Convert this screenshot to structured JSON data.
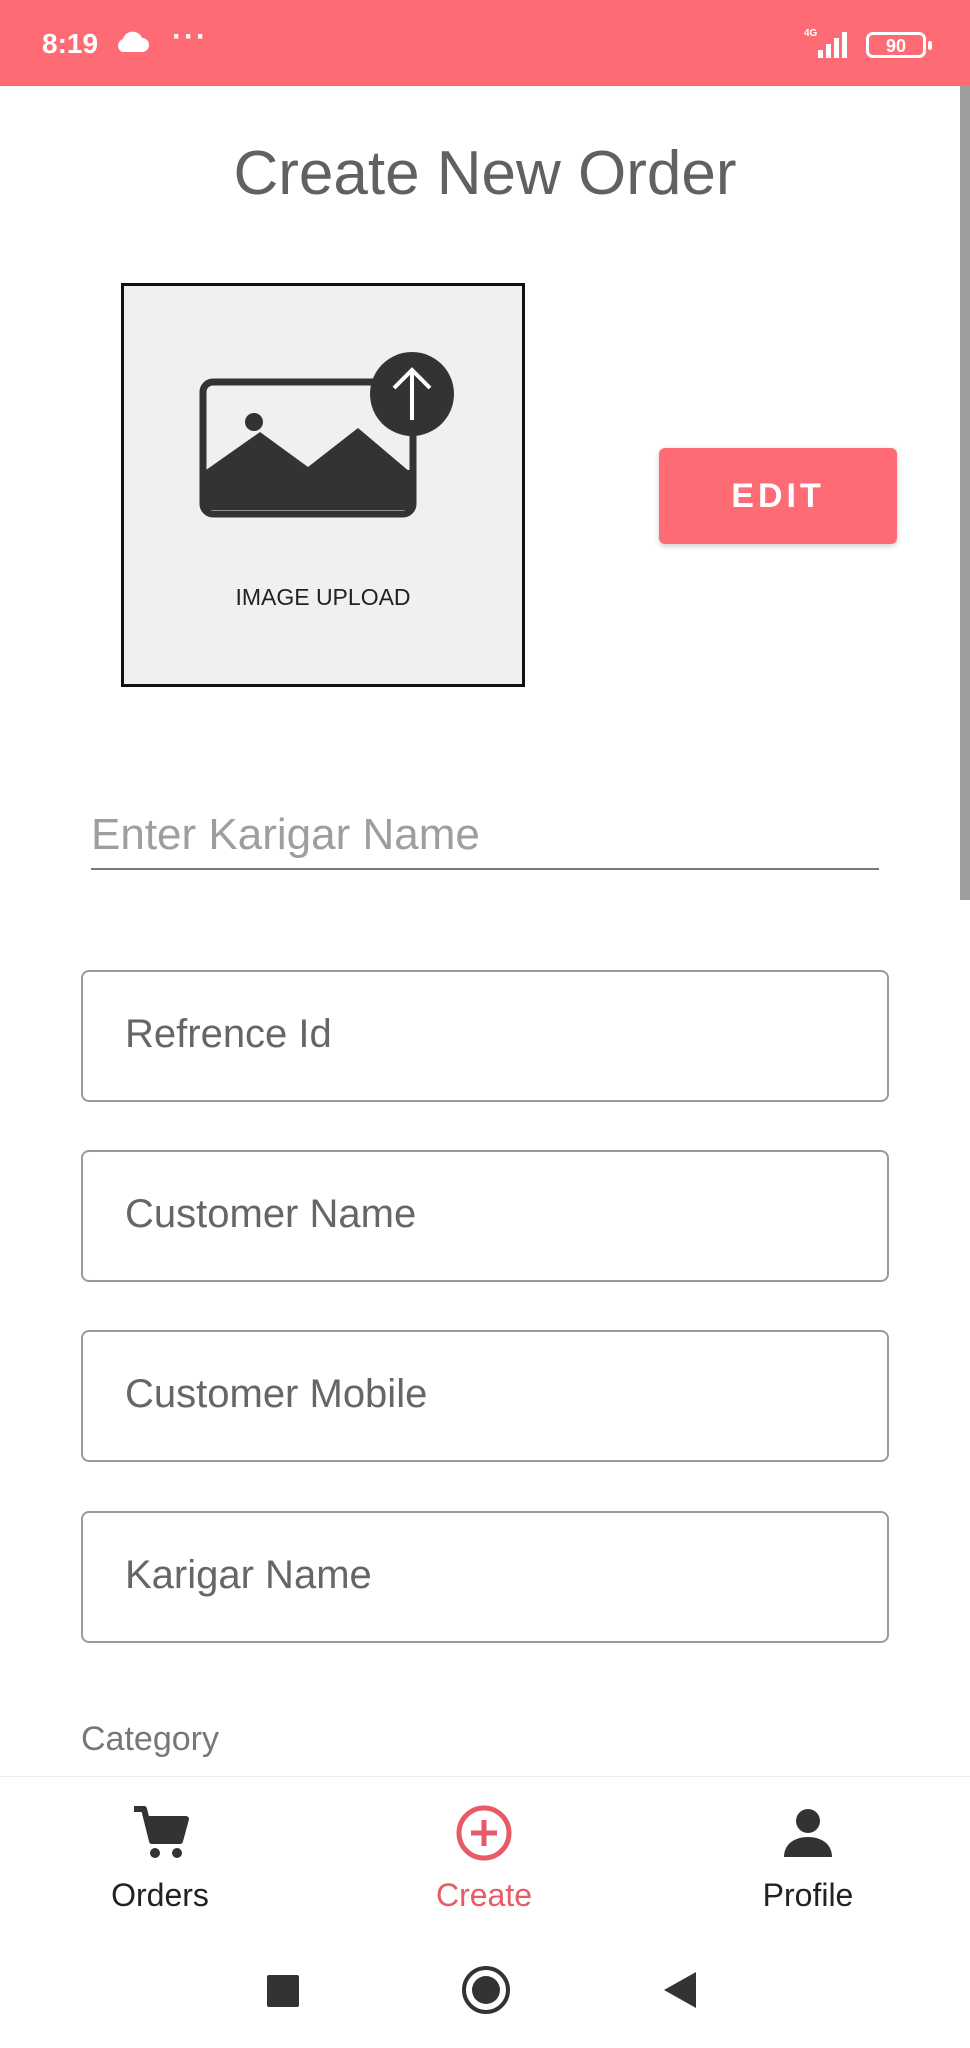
{
  "status_bar": {
    "time": "8:19",
    "dots": "···",
    "network": "4G",
    "battery": "90",
    "background_color": "#fe6b74"
  },
  "page": {
    "title": "Create New Order"
  },
  "image_upload": {
    "label": "IMAGE UPLOAD",
    "icon": "image-upload-icon"
  },
  "edit_button": {
    "label": "EDIT",
    "color": "#fe6b74"
  },
  "form": {
    "karigar_name_placeholder": "Enter Karigar Name",
    "fields": [
      {
        "placeholder": "Refrence Id"
      },
      {
        "placeholder": "Customer Name"
      },
      {
        "placeholder": "Customer Mobile"
      },
      {
        "placeholder": "Karigar Name"
      }
    ],
    "category_label": "Category"
  },
  "bottom_nav": {
    "items": [
      {
        "label": "Orders",
        "icon": "cart-icon",
        "active": false
      },
      {
        "label": "Create",
        "icon": "add-circle-icon",
        "active": true
      },
      {
        "label": "Profile",
        "icon": "person-icon",
        "active": false
      }
    ],
    "active_color": "#e85a66"
  },
  "system_nav": {
    "buttons": [
      "recents-icon",
      "home-icon",
      "back-icon"
    ]
  }
}
